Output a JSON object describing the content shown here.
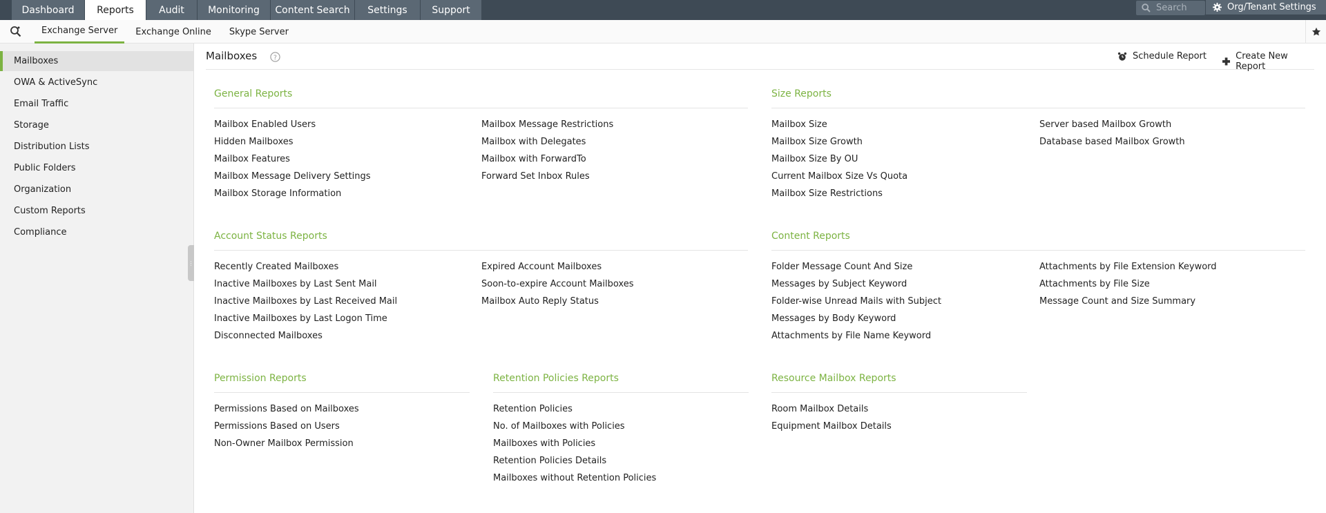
{
  "topnav": {
    "tabs": [
      "Dashboard",
      "Reports",
      "Audit",
      "Monitoring",
      "Content Search",
      "Settings",
      "Support"
    ],
    "search_placeholder": "Search",
    "org_label": "Org/Tenant Settings"
  },
  "subnav": {
    "tabs": [
      "Exchange Server",
      "Exchange Online",
      "Skype Server"
    ]
  },
  "sidebar": {
    "items": [
      "Mailboxes",
      "OWA & ActiveSync",
      "Email Traffic",
      "Storage",
      "Distribution Lists",
      "Public Folders",
      "Organization",
      "Custom Reports",
      "Compliance"
    ]
  },
  "page": {
    "title": "Mailboxes",
    "schedule_label": "Schedule Report",
    "create_label": "Create New Report"
  },
  "sections": {
    "general": {
      "title": "General Reports",
      "col1": [
        "Mailbox Enabled Users",
        "Hidden Mailboxes",
        "Mailbox Features",
        "Mailbox Message Delivery Settings",
        "Mailbox Storage Information"
      ],
      "col2": [
        "Mailbox Message Restrictions",
        "Mailbox with Delegates",
        "Mailbox with ForwardTo",
        "Forward Set Inbox Rules"
      ]
    },
    "size": {
      "title": "Size Reports",
      "col1": [
        "Mailbox Size",
        "Mailbox Size Growth",
        "Mailbox Size By OU",
        "Current Mailbox Size Vs Quota",
        "Mailbox Size Restrictions"
      ],
      "col2": [
        "Server based Mailbox Growth",
        "Database based Mailbox Growth"
      ]
    },
    "account": {
      "title": "Account Status Reports",
      "col1": [
        "Recently Created Mailboxes",
        "Inactive Mailboxes by Last Sent Mail",
        "Inactive Mailboxes by Last Received Mail",
        "Inactive Mailboxes by Last Logon Time",
        "Disconnected Mailboxes"
      ],
      "col2": [
        "Expired Account Mailboxes",
        "Soon-to-expire Account Mailboxes",
        "Mailbox Auto Reply Status"
      ]
    },
    "content": {
      "title": "Content Reports",
      "col1": [
        "Folder Message Count And Size",
        "Messages by Subject Keyword",
        "Folder-wise Unread Mails with Subject",
        "Messages by Body Keyword",
        "Attachments by File Name Keyword"
      ],
      "col2": [
        "Attachments by File Extension Keyword",
        "Attachments by File Size",
        "Message Count and Size Summary"
      ]
    },
    "permission": {
      "title": "Permission Reports",
      "col1": [
        "Permissions Based on Mailboxes",
        "Permissions Based on Users",
        "Non-Owner Mailbox Permission"
      ]
    },
    "retention": {
      "title": "Retention Policies Reports",
      "col1": [
        "Retention Policies",
        "No. of Mailboxes with Policies",
        "Mailboxes with Policies",
        "Retention Policies Details",
        "Mailboxes without Retention Policies"
      ]
    },
    "resource": {
      "title": "Resource Mailbox Reports",
      "col1": [
        "Room Mailbox Details",
        "Equipment Mailbox Details"
      ]
    }
  },
  "colors": {
    "accent": "#7cb342",
    "topbar": "#3e4a55",
    "tab": "#5b6874"
  },
  "icons": [
    "search-icon",
    "gear-icon",
    "magnifier-icon",
    "star-icon",
    "help-icon",
    "alarm-clock-icon",
    "plus-icon"
  ]
}
